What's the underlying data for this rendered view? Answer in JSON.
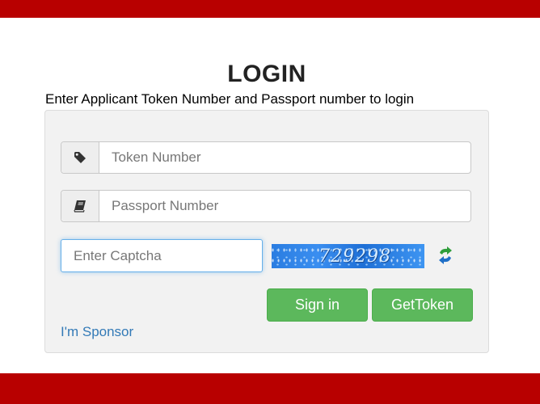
{
  "header": {
    "title": "LOGIN",
    "subtitle": "Enter Applicant Token Number and Passport number to login"
  },
  "form": {
    "token_placeholder": "Token Number",
    "token_icon": "tag-icon",
    "passport_placeholder": "Passport Number",
    "passport_icon": "book-icon",
    "captcha_placeholder": "Enter Captcha",
    "captcha_text": "729298",
    "refresh_icon": "refresh-icon"
  },
  "buttons": {
    "signin_label": "Sign in",
    "gettoken_label": "GetToken"
  },
  "links": {
    "sponsor_label": "I'm Sponsor"
  },
  "colors": {
    "brand_bar": "#b80000",
    "button_green": "#5cb85c",
    "link_blue": "#337ab7",
    "focus_blue": "#66afe9"
  }
}
